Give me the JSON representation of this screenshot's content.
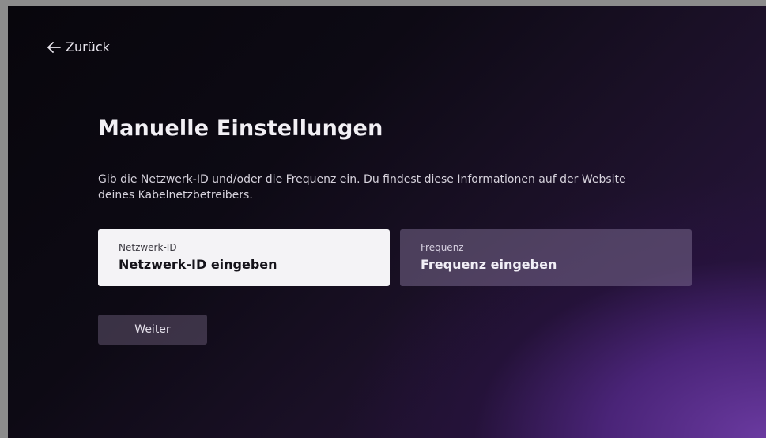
{
  "nav": {
    "back_label": "Zurück",
    "back_icon": "arrow-left-icon"
  },
  "page": {
    "title": "Manuelle Einstellungen",
    "description": "Gib die Netzwerk-ID und/oder die Frequenz ein. Du findest diese Informationen auf der Website deines Kabelnetzbetreibers."
  },
  "fields": [
    {
      "label": "Netzwerk-ID",
      "value": "Netzwerk-ID eingeben",
      "state": "focused"
    },
    {
      "label": "Frequenz",
      "value": "Frequenz eingeben",
      "state": "unfocused"
    }
  ],
  "actions": {
    "continue_label": "Weiter"
  },
  "colors": {
    "background_dark": "#0d0a14",
    "background_accent": "#6a3aa0",
    "focused_field": "#f4f3f6",
    "unfocused_field": "#5e5070"
  }
}
